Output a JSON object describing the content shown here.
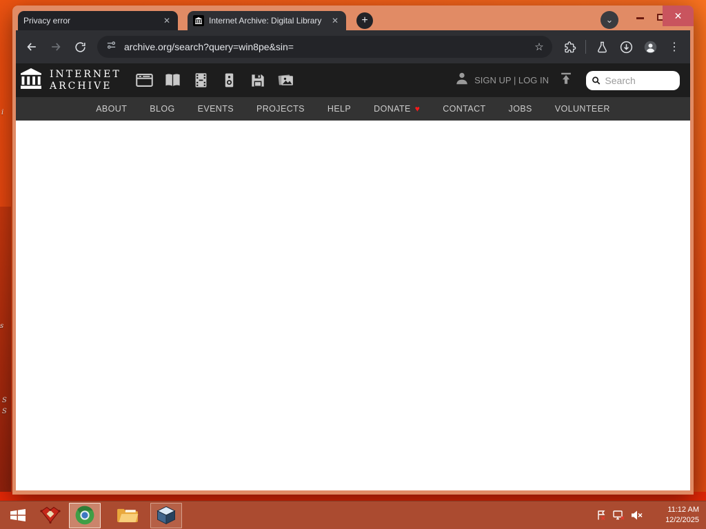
{
  "browser": {
    "tabs": [
      {
        "title": "Privacy error"
      },
      {
        "title": "Internet Archive: Digital Library"
      }
    ],
    "url": "archive.org/search?query=win8pe&sin="
  },
  "archive": {
    "wordmark_line1": "INTERNET",
    "wordmark_line2": "ARCHIVE",
    "auth": "SIGN UP | LOG IN",
    "search_placeholder": "Search",
    "nav": [
      "ABOUT",
      "BLOG",
      "EVENTS",
      "PROJECTS",
      "HELP",
      "DONATE",
      "CONTACT",
      "JOBS",
      "VOLUNTEER"
    ]
  },
  "taskbar": {
    "time": "11:12 AM",
    "date": "12/2/2025"
  },
  "desktop": {
    "fragments": [
      "i",
      "s",
      "S",
      "S"
    ]
  },
  "icons": {
    "new_tab": "+",
    "tab_search_chevron": "⌄",
    "close": "✕",
    "star": "☆",
    "kebab": "⋮",
    "heart": "♥"
  },
  "colors": {
    "window_frame": "#e18b65",
    "toolbar": "#2e2f33",
    "ia_header": "#1d1d1d",
    "ia_navbar": "#333333",
    "taskbar": "#ab4b30",
    "close_button": "#c9545e",
    "donate_heart": "#ff1a1a"
  }
}
